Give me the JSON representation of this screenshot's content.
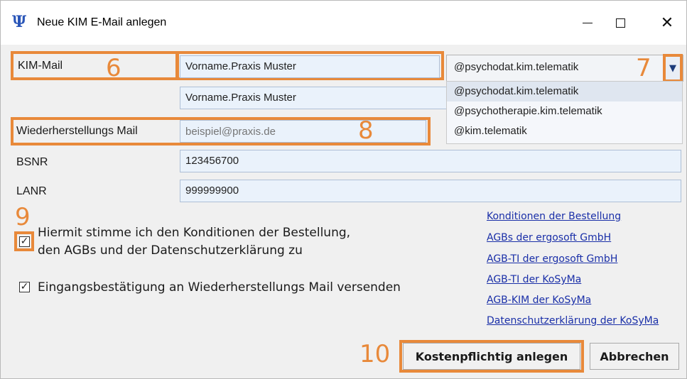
{
  "window": {
    "title": "Neue KIM E-Mail anlegen",
    "icon": "psi-app-icon",
    "controls": {
      "minimize": "minimize-icon",
      "maximize": "maximize-icon",
      "close": "close-icon"
    }
  },
  "accent_color": "#e8893a",
  "form": {
    "kim_mail": {
      "label": "KIM-Mail",
      "value": "Vorname.Praxis Muster",
      "callout": "6"
    },
    "kim_mail_second": {
      "value": "Vorname.Praxis Muster"
    },
    "domain": {
      "selected": "@psychodat.kim.telematik",
      "callout": "7",
      "options": [
        "@psychodat.kim.telematik",
        "@psychotherapie.kim.telematik",
        "@kim.telematik"
      ]
    },
    "recovery": {
      "label": "Wiederherstellungs Mail",
      "placeholder": "beispiel@praxis.de",
      "callout": "8"
    },
    "bsnr": {
      "label": "BSNR",
      "value": "123456700"
    },
    "lanr": {
      "label": "LANR",
      "value": "999999900"
    }
  },
  "consent": {
    "callout": "9",
    "checked": true,
    "line1": "Hiermit stimme ich den Konditionen der Bestellung,",
    "line2": "den AGBs und der Datenschutzerklärung zu"
  },
  "receipt": {
    "checked": true,
    "label": "Eingangsbestätigung an Wiederherstellungs Mail versenden"
  },
  "links": [
    "Konditionen der Bestellung",
    "AGBs der ergosoft GmbH",
    "AGB-TI der ergosoft GmbH",
    "AGB-TI der KoSyMa",
    "AGB-KIM der KoSyMa",
    "Datenschutzerklärung der KoSyMa"
  ],
  "buttons": {
    "callout": "10",
    "create": "Kostenpflichtig anlegen",
    "cancel": "Abbrechen"
  }
}
